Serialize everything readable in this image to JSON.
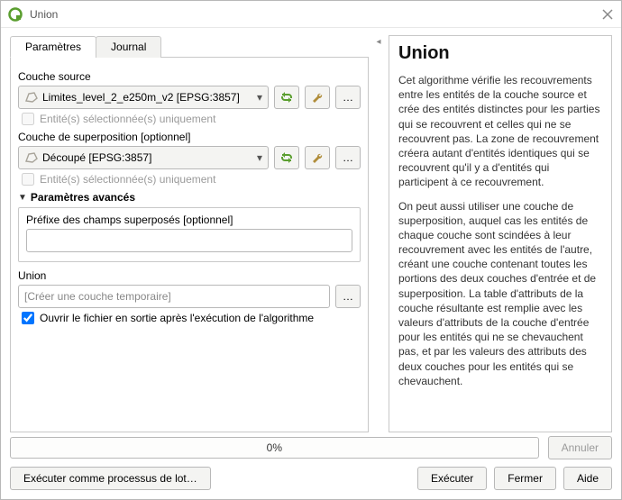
{
  "window": {
    "title": "Union"
  },
  "tabs": {
    "parameters": "Paramètres",
    "log": "Journal",
    "active": "parameters"
  },
  "source": {
    "label": "Couche source",
    "value": "Limites_level_2_e250m_v2 [EPSG:3857]",
    "selected_only": "Entité(s) sélectionnée(s) uniquement",
    "selected_only_enabled": false
  },
  "overlay": {
    "label": "Couche de superposition [optionnel]",
    "value": "Découpé [EPSG:3857]",
    "selected_only": "Entité(s) sélectionnée(s) uniquement",
    "selected_only_enabled": false
  },
  "advanced": {
    "header": "Paramètres avancés",
    "prefix_label": "Préfixe des champs superposés [optionnel]",
    "prefix_value": ""
  },
  "output": {
    "label": "Union",
    "placeholder": "[Créer une couche temporaire]",
    "open_after": "Ouvrir le fichier en sortie après l'exécution de l'algorithme",
    "open_after_checked": true
  },
  "help": {
    "title": "Union",
    "p1": "Cet algorithme vérifie les recouvrements entre les entités de la couche source et crée des entités distinctes pour les parties qui se recouvrent et celles qui ne se recouvrent pas. La zone de recouvrement créera autant d'entités identiques qui se recouvrent qu'il y a d'entités qui participent à ce recouvrement.",
    "p2": "On peut aussi utiliser une couche de superposition, auquel cas les entités de chaque couche sont scindées à leur recouvrement avec les entités de l'autre, créant une couche contenant toutes les portions des deux couches d'entrée et de superposition. La table d'attributs de la couche résultante est remplie avec les valeurs d'attributs de la couche d'entrée pour les entités qui ne se chevauchent pas, et par les valeurs des attributs des deux couches pour les entités qui se chevauchent."
  },
  "progress": {
    "text": "0%"
  },
  "buttons": {
    "batch": "Exécuter comme processus de lot…",
    "run": "Exécuter",
    "close": "Fermer",
    "help": "Aide",
    "cancel": "Annuler"
  },
  "icons": {
    "iterate_title": "Itérer",
    "options_title": "Options",
    "browse_title": "…"
  }
}
